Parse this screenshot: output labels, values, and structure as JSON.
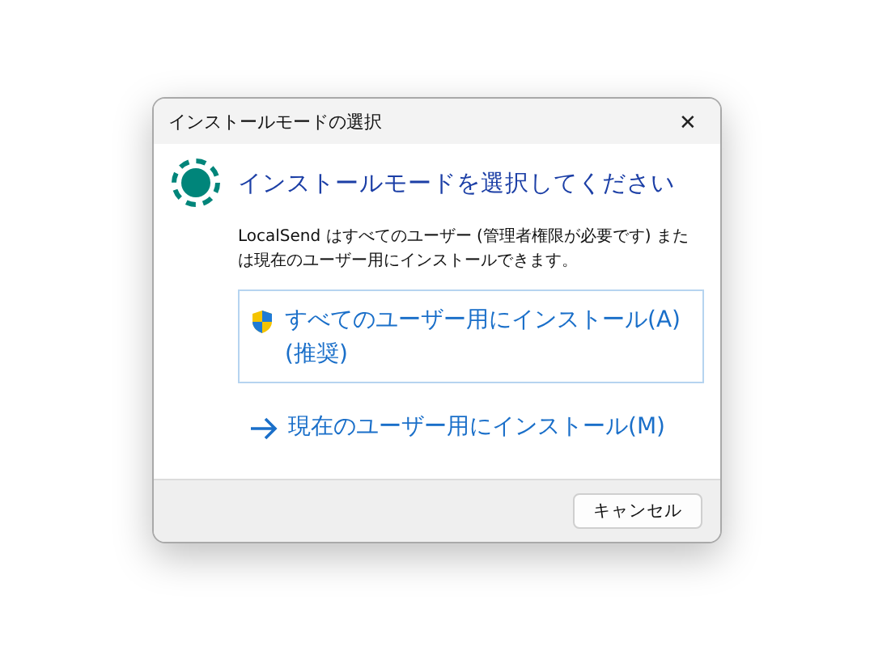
{
  "window": {
    "title": "インストールモードの選択",
    "close": "✕"
  },
  "heading": "インストールモードを選択してください",
  "description": "LocalSend はすべてのユーザー (管理者権限が必要です) または現在のユーザー用にインストールできます。",
  "options": [
    {
      "kind": "shield",
      "label": "すべてのユーザー用にインストール(A) (推奨)",
      "selected": true
    },
    {
      "kind": "arrow",
      "label": "現在のユーザー用にインストール(M)",
      "selected": false
    }
  ],
  "buttons": [
    "キャンセル"
  ]
}
